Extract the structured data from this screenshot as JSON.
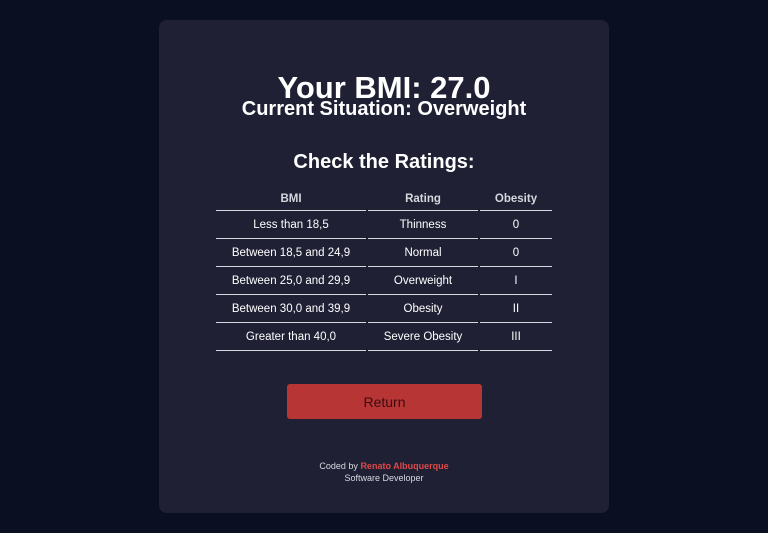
{
  "result": {
    "bmi_text": "Your BMI: 27.0",
    "situation_text": "Current Situation: Overweight"
  },
  "ratings": {
    "title": "Check the Ratings:",
    "headers": [
      "BMI",
      "Rating",
      "Obesity"
    ],
    "rows": [
      [
        "Less than 18,5",
        "Thinness",
        "0"
      ],
      [
        "Between 18,5 and 24,9",
        "Normal",
        "0"
      ],
      [
        "Between 25,0 and 29,9",
        "Overweight",
        "I"
      ],
      [
        "Between 30,0 and 39,9",
        "Obesity",
        "II"
      ],
      [
        "Greater than 40,0",
        "Severe Obesity",
        "III"
      ]
    ]
  },
  "actions": {
    "return_label": "Return"
  },
  "footer": {
    "coded_by": "Coded by",
    "author": "Renato Albuquerque",
    "role": "Software Developer"
  },
  "colors": {
    "background": "#0b0f22",
    "card": "#1f2034",
    "accent": "#b83535",
    "author": "#e04848"
  }
}
